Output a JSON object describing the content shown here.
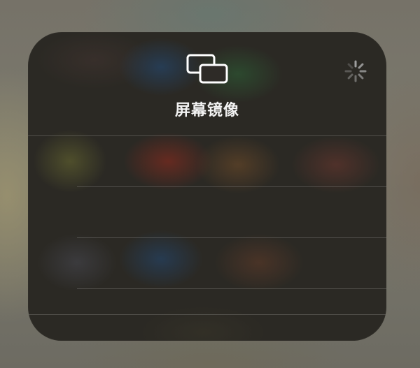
{
  "screen_mirroring": {
    "title": "屏幕镜像",
    "icon": "screen-mirroring-icon",
    "status_indicator": "loading-spinner-icon",
    "device_rows": [
      {
        "label": ""
      },
      {
        "label": ""
      },
      {
        "label": ""
      }
    ]
  },
  "colors": {
    "title_text": "#f2f2f2",
    "icon_stroke": "#ffffff",
    "spinner": "#9f9f9f",
    "divider": "rgba(255,255,255,0.18)"
  }
}
